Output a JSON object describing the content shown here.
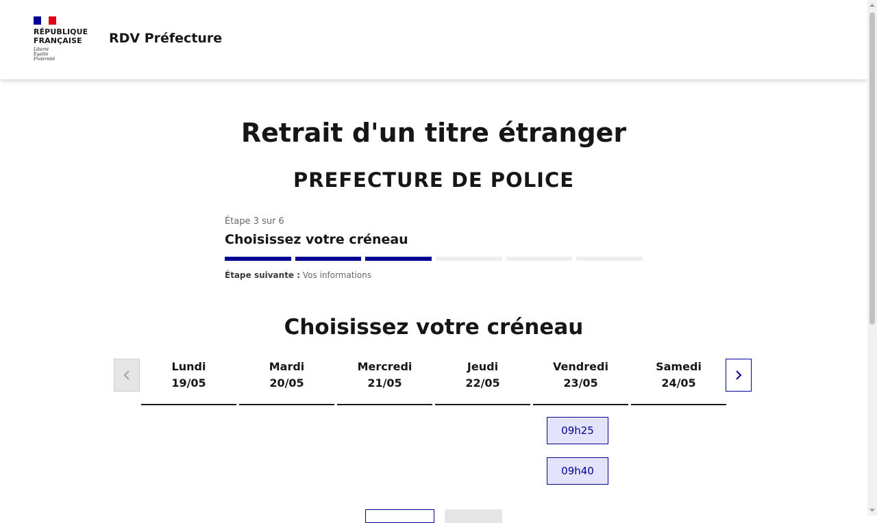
{
  "header": {
    "logo_title": "RÉPUBLIQUE\nFRANÇAISE",
    "logo_motto": "Liberté\nÉgalité\nFraternité",
    "service_name": "RDV Préfecture",
    "flag_colors": [
      "#000091",
      "#ffffff",
      "#e1000f"
    ]
  },
  "page": {
    "title": "Retrait d'un titre étranger",
    "organization": "PREFECTURE DE POLICE"
  },
  "stepper": {
    "state": "Étape 3 sur 6",
    "current_title": "Choisissez votre créneau",
    "current_step": 3,
    "total_steps": 6,
    "next_label": "Étape suivante :",
    "next_value": "Vos informations"
  },
  "calendar": {
    "section_title": "Choisissez votre créneau",
    "prev_icon": "chevron-left-icon",
    "next_icon": "chevron-right-icon",
    "days": [
      {
        "name": "Lundi",
        "date": "19/05",
        "slots": []
      },
      {
        "name": "Mardi",
        "date": "20/05",
        "slots": []
      },
      {
        "name": "Mercredi",
        "date": "21/05",
        "slots": []
      },
      {
        "name": "Jeudi",
        "date": "22/05",
        "slots": []
      },
      {
        "name": "Vendredi",
        "date": "23/05",
        "slots": [
          "09h25",
          "09h40"
        ]
      },
      {
        "name": "Samedi",
        "date": "24/05",
        "slots": []
      }
    ]
  },
  "colors": {
    "primary": "#000091",
    "slot_background": "#e3e3fd",
    "disabled": "#e5e5e5"
  }
}
